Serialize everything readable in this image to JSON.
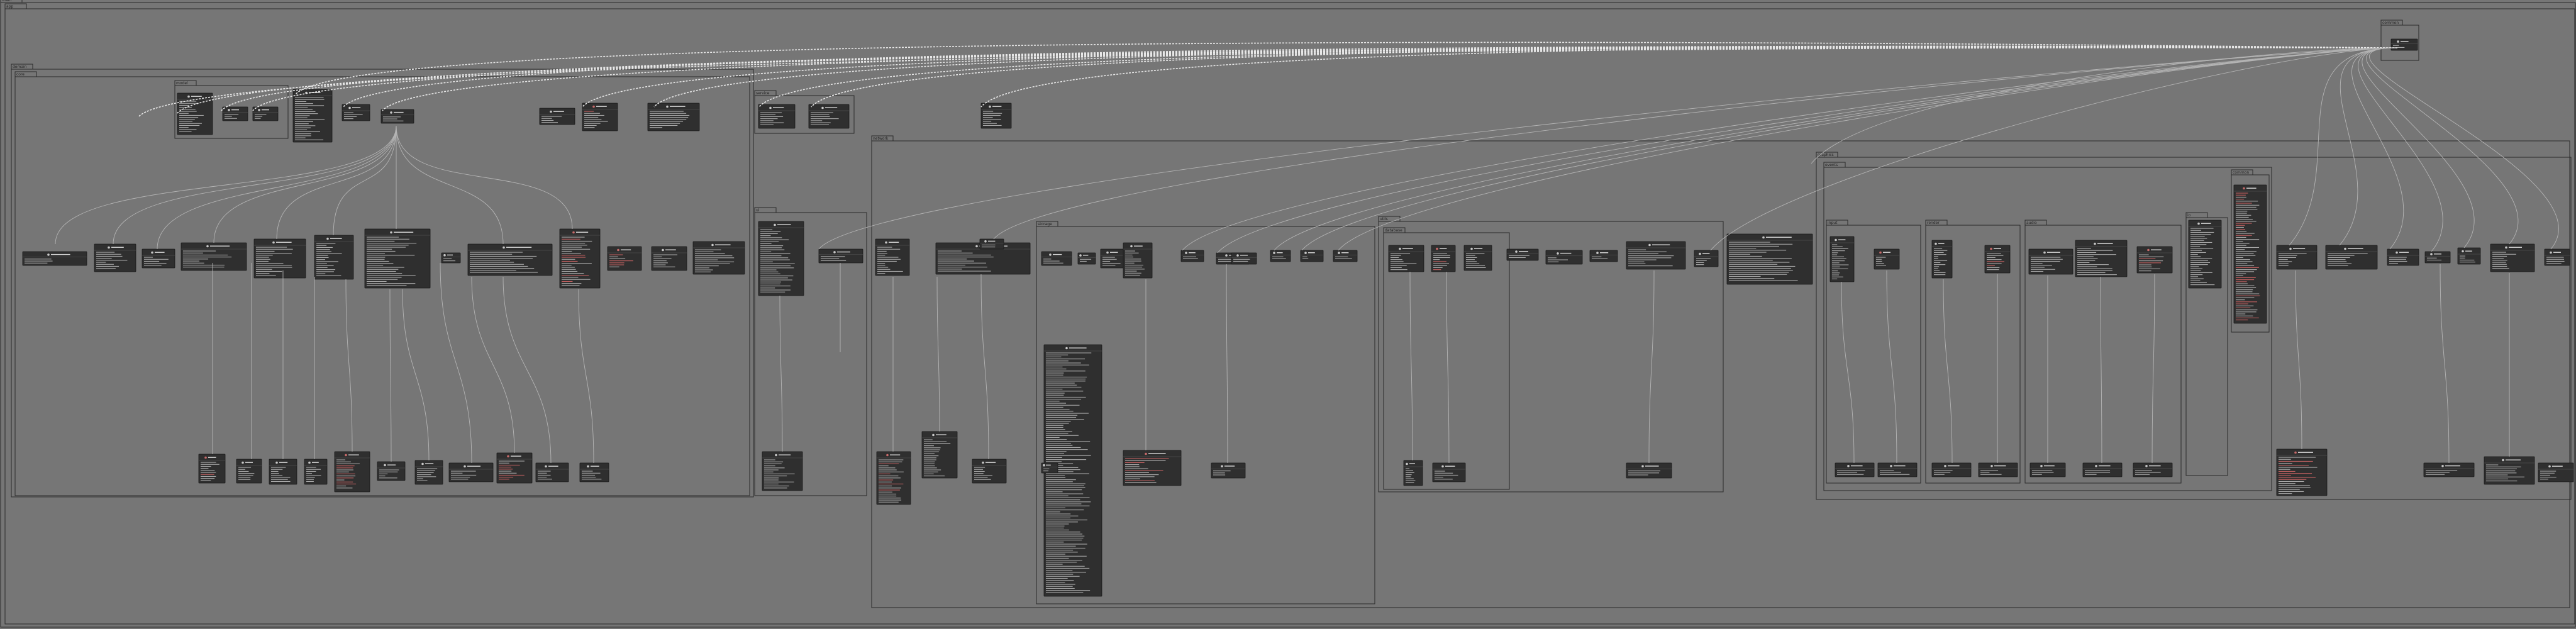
{
  "diagram": {
    "root_package": "main",
    "packages": [
      {
        "id": "p0",
        "label": "main"
      },
      {
        "id": "p1",
        "label": "app"
      },
      {
        "id": "p2",
        "label": "domain"
      },
      {
        "id": "p3",
        "label": "core"
      },
      {
        "id": "p4",
        "label": "model"
      },
      {
        "id": "p5",
        "label": "service"
      },
      {
        "id": "p6",
        "label": "ui"
      },
      {
        "id": "p7",
        "label": "network"
      },
      {
        "id": "p8",
        "label": "storage"
      },
      {
        "id": "p9",
        "label": "utils"
      },
      {
        "id": "p10",
        "label": "database"
      },
      {
        "id": "p11",
        "label": "graphics"
      },
      {
        "id": "p12",
        "label": "events"
      },
      {
        "id": "p13",
        "label": "input"
      },
      {
        "id": "p14",
        "label": "render"
      },
      {
        "id": "p15",
        "label": "audio"
      },
      {
        "id": "p16",
        "label": "io"
      },
      {
        "id": "p17",
        "label": "common"
      }
    ],
    "colors": {
      "background": "#767676",
      "frame": "#2a2a2a",
      "class_fill": "#2f2f2f",
      "class_text": "#e6e6e6",
      "edge": "#b4b4b4",
      "dependency": "#e8e8e8",
      "stereotype_class": "#c9c9c9",
      "stereotype_interface": "#c96a6a"
    },
    "legibility_note": ""
  }
}
